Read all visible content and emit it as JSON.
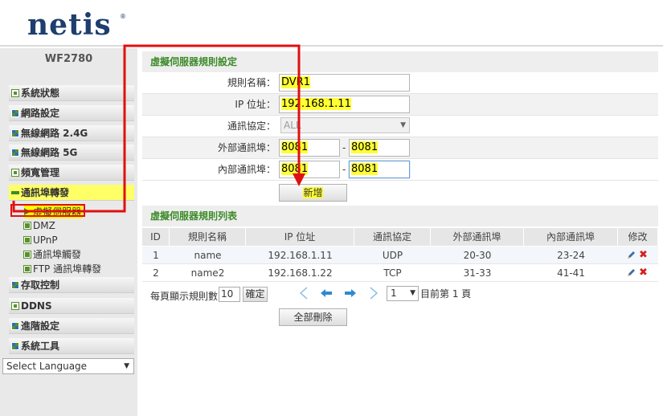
{
  "header": {
    "logo": "netis",
    "logo_mark": "®"
  },
  "sidebar": {
    "model": "WF2780",
    "menu": [
      {
        "label": "系統狀態",
        "icon": "dot-square-icon"
      },
      {
        "label": "網路設定",
        "icon": "grid-icon"
      },
      {
        "label": "無線網路 2.4G",
        "icon": "grid-icon"
      },
      {
        "label": "無線網路 5G",
        "icon": "grid-icon"
      },
      {
        "label": "頻寬管理",
        "icon": "dot-square-icon"
      },
      {
        "label": "通訊埠轉發",
        "icon": "minus-icon"
      },
      {
        "label": "存取控制",
        "icon": "grid-icon"
      },
      {
        "label": "DDNS",
        "icon": "dot-square-icon"
      },
      {
        "label": "進階設定",
        "icon": "grid-icon"
      },
      {
        "label": "系統工具",
        "icon": "grid-icon"
      }
    ],
    "submenu": [
      {
        "label": "虛擬伺服器"
      },
      {
        "label": "DMZ"
      },
      {
        "label": "UPnP"
      },
      {
        "label": "通訊埠觸發"
      },
      {
        "label": "FTP 通訊埠轉發"
      }
    ],
    "language": "Select Language"
  },
  "form": {
    "title": "虛擬伺服器規則設定",
    "rule_name_label": "規則名稱：",
    "rule_name_value": "DVR1",
    "ip_label": "IP 位址：",
    "ip_value": "192.168.1.11",
    "protocol_label": "通訊協定：",
    "protocol_value": "ALL",
    "ext_port_label": "外部通訊埠：",
    "ext_port_start": "8081",
    "ext_port_end": "8081",
    "int_port_label": "內部通訊埠：",
    "int_port_start": "8081",
    "int_port_end": "8081",
    "range_separator": "-",
    "add_button": "新增"
  },
  "list": {
    "title": "虛擬伺服器規則列表",
    "columns": [
      "ID",
      "規則名稱",
      "IP 位址",
      "通訊協定",
      "外部通訊埠",
      "內部通訊埠",
      "修改"
    ],
    "rows": [
      {
        "id": "1",
        "name": "name",
        "ip": "192.168.1.11",
        "protocol": "UDP",
        "ext": "20-30",
        "int": "23-24"
      },
      {
        "id": "2",
        "name": "name2",
        "ip": "192.168.1.22",
        "protocol": "TCP",
        "ext": "31-33",
        "int": "41-41"
      }
    ],
    "per_page_label": "每頁顯示規則數",
    "per_page_value": "10",
    "confirm_button": "確定",
    "page_value": "1",
    "page_info": "目前第 1 頁",
    "delete_all_button": "全部刪除"
  },
  "colors": {
    "accent_green": "#3d8b2a",
    "highlight": "#ffff00",
    "annotation_red": "#e01010",
    "logo_navy": "#1d3e6e"
  }
}
